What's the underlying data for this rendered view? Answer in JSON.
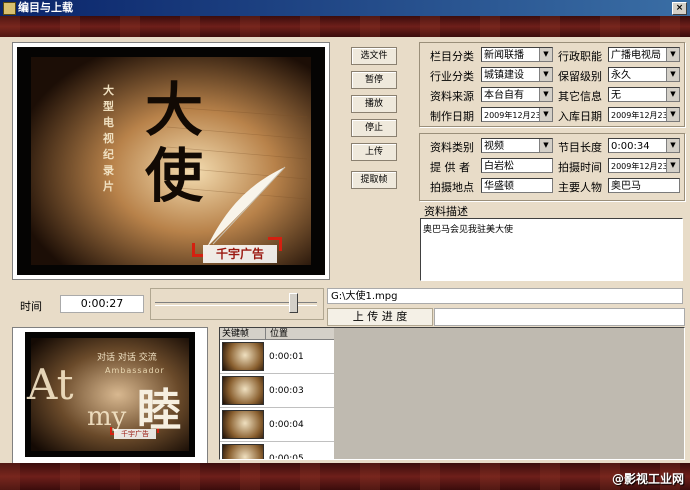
{
  "window": {
    "title": "编目与上载",
    "close_glyph": "×"
  },
  "buttons": {
    "select_file": "选文件",
    "pause": "暂停",
    "play": "播放",
    "stop": "停止",
    "upload": "上传",
    "extract_frame": "提取帧"
  },
  "preview": {
    "title_text": "大使",
    "vertical_text": "大型电视纪录片",
    "brand_text": "千宇广告"
  },
  "thumbnail": {
    "big_letters": "At",
    "big_char": "睦",
    "small_letter": "my",
    "tagline": "对话 对话 交流",
    "subtitle": "Ambassador",
    "brand_text": "千宇广告"
  },
  "metadata": {
    "column_category": {
      "label": "栏目分类",
      "value": "新闻联播"
    },
    "admin_function": {
      "label": "行政职能",
      "value": "广播电视局"
    },
    "industry": {
      "label": "行业分类",
      "value": "城镇建设"
    },
    "retention": {
      "label": "保留级别",
      "value": "永久"
    },
    "source": {
      "label": "资料来源",
      "value": "本台自有"
    },
    "other_info": {
      "label": "其它信息",
      "value": "无"
    },
    "production_date": {
      "label": "制作日期",
      "value": "2009年12月23日"
    },
    "storage_date": {
      "label": "入库日期",
      "value": "2009年12月23日"
    }
  },
  "details": {
    "material_type": {
      "label": "资料类别",
      "value": "视频"
    },
    "program_length": {
      "label": "节目长度",
      "value": "0:00:34"
    },
    "provider": {
      "label": "提 供 者",
      "value": "白岩松"
    },
    "shoot_time": {
      "label": "拍摄时间",
      "value": "2009年12月23日"
    },
    "shoot_location": {
      "label": "拍摄地点",
      "value": "华盛顿"
    },
    "main_person": {
      "label": "主要人物",
      "value": "奥巴马"
    }
  },
  "description": {
    "label": "资料描述",
    "value": "奥巴马会见我驻美大使"
  },
  "playback": {
    "time_label": "时间",
    "time_value": "0:00:27",
    "slider_position": 0.86
  },
  "file": {
    "path": "G:\\大使1.mpg"
  },
  "progress": {
    "label": "上 传 进 度",
    "value": 0
  },
  "keyframes": {
    "headers": [
      "关键帧",
      "位置"
    ],
    "rows": [
      {
        "position": "0:00:01"
      },
      {
        "position": "0:00:03"
      },
      {
        "position": "0:00:04"
      },
      {
        "position": "0:00:05"
      }
    ]
  },
  "watermark": "@影视工业网",
  "colors": {
    "panel": "#e8dcc8",
    "band": "#5a1612",
    "titlebar": "#0a246a"
  }
}
